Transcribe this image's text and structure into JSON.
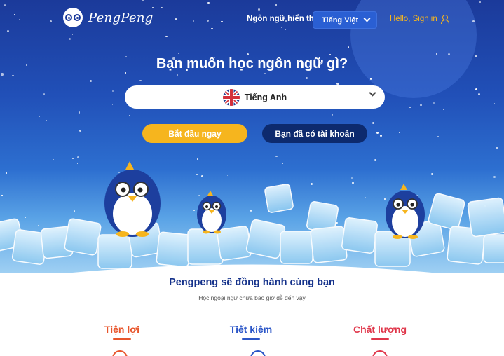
{
  "header": {
    "brand": "PengPeng",
    "language_label": "Ngôn ngữ hiển thị",
    "language_selected": "Tiếng Việt",
    "signin_label": "Hello, Sign in"
  },
  "hero": {
    "headline": "Bạn muốn học ngôn ngữ gì?",
    "target_language": "Tiếng Anh",
    "primary_button": "Bắt đầu ngay",
    "secondary_button": "Bạn đã có tài khoản"
  },
  "section": {
    "title": "Pengpeng sẽ đồng hành cùng bạn",
    "subtitle": "Học ngoại ngữ chưa bao giờ dễ đến vậy"
  },
  "features": [
    {
      "label": "Tiện lợi",
      "color": "#e8552b"
    },
    {
      "label": "Tiết kiệm",
      "color": "#2a55c7"
    },
    {
      "label": "Chất lượng",
      "color": "#e0364a"
    }
  ],
  "colors": {
    "accent": "#f6b51e",
    "navy": "#0d2a6e",
    "brand_blue": "#15328b"
  },
  "icons": [
    "pengpeng-logo-icon",
    "chevron-down-icon",
    "user-icon",
    "uk-flag-icon"
  ]
}
